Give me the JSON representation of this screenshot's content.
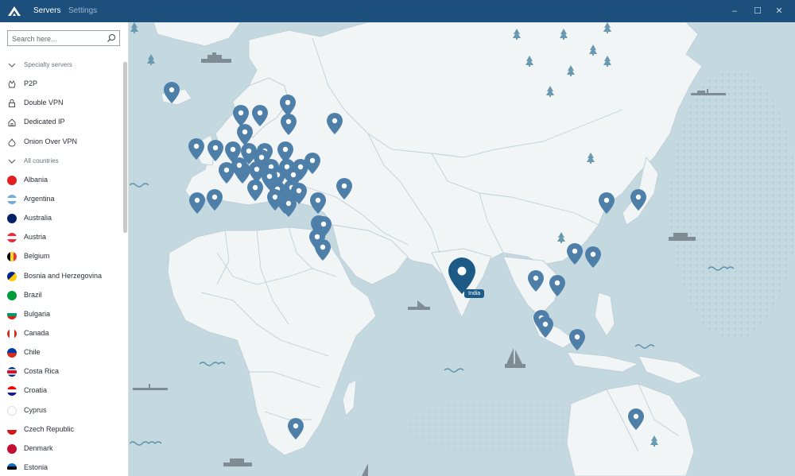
{
  "titlebar": {
    "tabs": [
      {
        "label": "Servers",
        "active": true
      },
      {
        "label": "Settings",
        "active": false
      }
    ]
  },
  "sidebar": {
    "search_placeholder": "Search here...",
    "specialty_header": "Specialty servers",
    "specialty": [
      {
        "label": "P2P",
        "icon": "p2p-icon"
      },
      {
        "label": "Double VPN",
        "icon": "lock-icon"
      },
      {
        "label": "Dedicated IP",
        "icon": "home-icon"
      },
      {
        "label": "Onion Over VPN",
        "icon": "onion-icon"
      }
    ],
    "countries_header": "All countries",
    "countries": [
      {
        "label": "Albania"
      },
      {
        "label": "Argentina"
      },
      {
        "label": "Australia"
      },
      {
        "label": "Austria"
      },
      {
        "label": "Belgium"
      },
      {
        "label": "Bosnia and Herzegovina"
      },
      {
        "label": "Brazil"
      },
      {
        "label": "Bulgaria"
      },
      {
        "label": "Canada"
      },
      {
        "label": "Chile"
      },
      {
        "label": "Costa Rica"
      },
      {
        "label": "Croatia"
      },
      {
        "label": "Cyprus"
      },
      {
        "label": "Czech Republic"
      },
      {
        "label": "Denmark"
      },
      {
        "label": "Estonia"
      }
    ]
  },
  "map": {
    "highlighted_label": "India",
    "colors": {
      "sea": "#c4d8e0",
      "land": "#f2f5f6",
      "border": "#bfd0d8",
      "pin": "#4e7fa8",
      "pin_active": "#1d5a86"
    }
  }
}
